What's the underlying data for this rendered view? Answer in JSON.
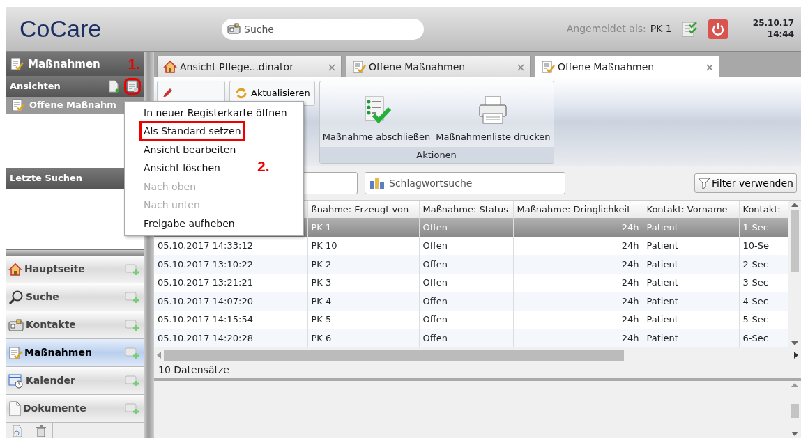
{
  "app": {
    "logo": "CoCare",
    "search_placeholder": "Suche",
    "login_label": "Angemeldet als:",
    "user": "PK 1",
    "date": "25.10.17",
    "time": "14:44"
  },
  "sidebar": {
    "title": "Maßnahmen",
    "step_label": "1.",
    "views_header": "Ansichten",
    "view_tools": [
      {
        "highlighted": false
      },
      {
        "highlighted": true
      }
    ],
    "views": [
      {
        "label": "Offene Maßnahm",
        "selected": true
      }
    ],
    "recent_header": "Letzte Suchen",
    "nav": [
      {
        "label": "Hauptseite",
        "selected": false
      },
      {
        "label": "Suche",
        "selected": false
      },
      {
        "label": "Kontakte",
        "selected": false
      },
      {
        "label": "Maßnahmen",
        "selected": true
      },
      {
        "label": "Kalender",
        "selected": false
      },
      {
        "label": "Dokumente",
        "selected": false
      }
    ]
  },
  "tabs": [
    {
      "label": "Ansicht Pflege...dinator",
      "selected": false
    },
    {
      "label": "Offene Maßnahmen",
      "selected": false
    },
    {
      "label": "Offene Maßnahmen",
      "selected": true
    }
  ],
  "ribbon": {
    "buttons": [
      {
        "label": "Aktualisieren"
      }
    ],
    "group": {
      "label": "Aktionen",
      "buttons": [
        {
          "label": "Maßnahme abschließen"
        },
        {
          "label": "Maßnahmenliste drucken"
        }
      ]
    }
  },
  "filter": {
    "keyword_search": "Schlagwortsuche",
    "filter_button": "Filter verwenden"
  },
  "table": {
    "columns": [
      null,
      "ßnahme: Erzeugt von",
      "Maßnahme: Status",
      "Maßnahme: Dringlichkeit",
      "Kontakt: Vorname",
      "Kontakt:"
    ],
    "rows": [
      {
        "selected": true,
        "cells": [
          null,
          "PK 1",
          "Offen",
          "24h",
          "Patient",
          "1-Sec"
        ]
      },
      {
        "selected": false,
        "cells": [
          "05.10.2017 14:33:12",
          "PK 10",
          "Offen",
          "24h",
          "Patient",
          "10-Se"
        ]
      },
      {
        "selected": false,
        "cells": [
          "05.10.2017 13:10:22",
          "PK 2",
          "Offen",
          "24h",
          "Patient",
          "2-Sec"
        ]
      },
      {
        "selected": false,
        "cells": [
          "05.10.2017 13:21:21",
          "PK 3",
          "Offen",
          "24h",
          "Patient",
          "3-Sec"
        ]
      },
      {
        "selected": false,
        "cells": [
          "05.10.2017 14:07:20",
          "PK 4",
          "Offen",
          "24h",
          "Patient",
          "4-Sec"
        ]
      },
      {
        "selected": false,
        "cells": [
          "05.10.2017 14:15:54",
          "PK 5",
          "Offen",
          "24h",
          "Patient",
          "5-Sec"
        ]
      },
      {
        "selected": false,
        "cells": [
          "05.10.2017 14:20:28",
          "PK 6",
          "Offen",
          "24h",
          "Patient",
          "6-Sec"
        ]
      }
    ],
    "footer": "10 Datensätze"
  },
  "context_menu": {
    "step_label": "2.",
    "items": [
      {
        "label": "In neuer Registerkarte öffnen",
        "disabled": false,
        "highlighted": false
      },
      {
        "label": "Als Standard setzen",
        "disabled": false,
        "highlighted": true
      },
      {
        "label": "Ansicht bearbeiten",
        "disabled": false,
        "highlighted": false
      },
      {
        "label": "Ansicht löschen",
        "disabled": false,
        "highlighted": false
      },
      {
        "label": "Nach oben",
        "disabled": true,
        "highlighted": false
      },
      {
        "label": "Nach unten",
        "disabled": true,
        "highlighted": false
      },
      {
        "label": "Freigabe aufheben",
        "disabled": false,
        "highlighted": false
      }
    ]
  }
}
